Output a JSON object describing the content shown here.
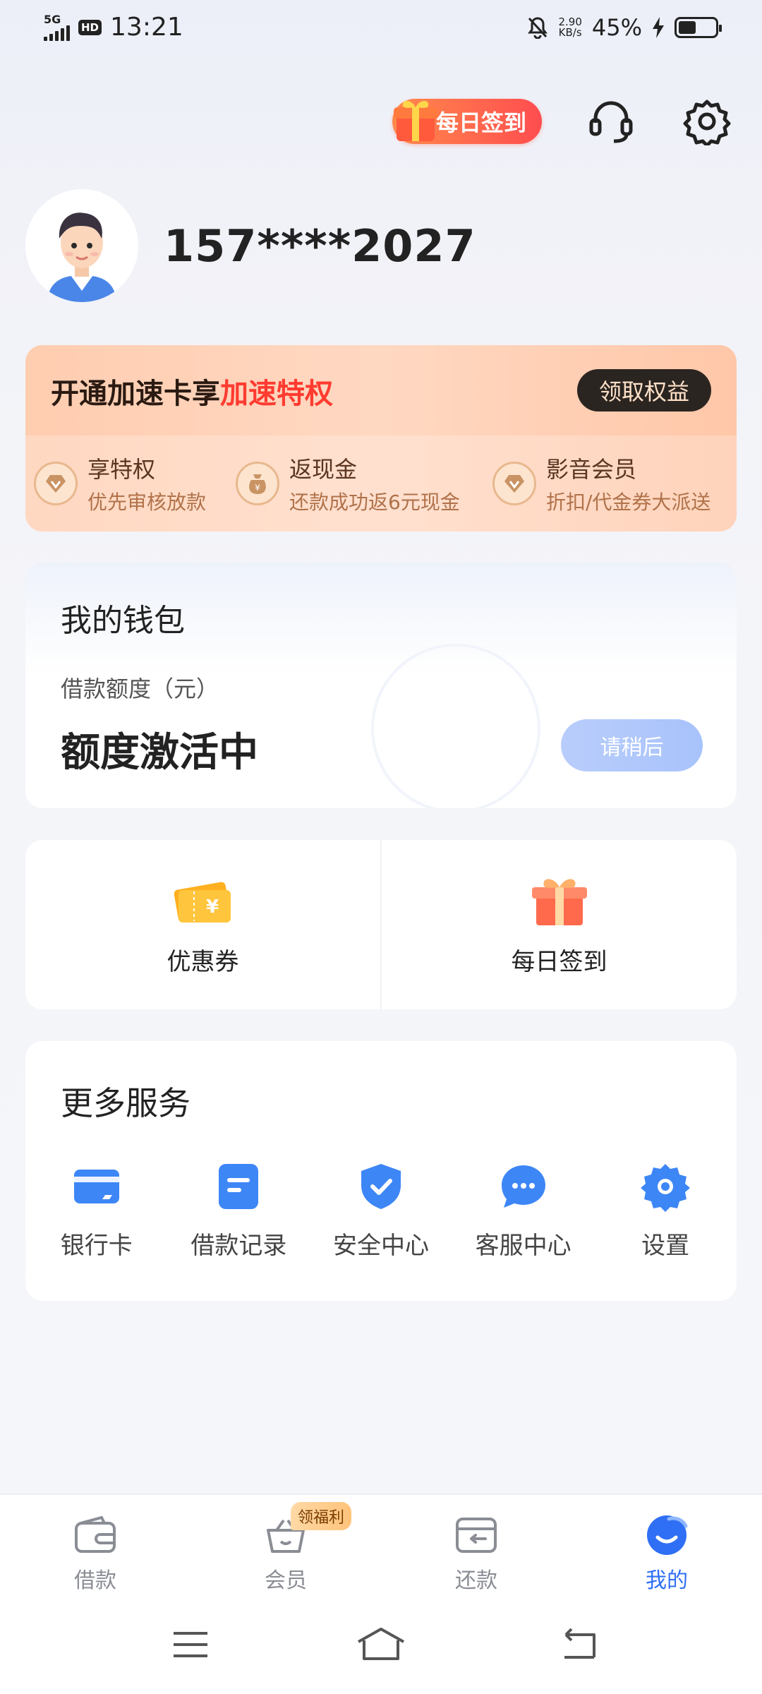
{
  "status_bar": {
    "network": "5G",
    "hd": "HD",
    "time": "13:21",
    "speed_value": "2.90",
    "speed_unit": "KB/s",
    "battery": "45%"
  },
  "header": {
    "checkin_label": "每日签到"
  },
  "profile": {
    "phone": "157****2027"
  },
  "promo": {
    "title_prefix": "开通加速卡享",
    "title_highlight": "加速特权",
    "button": "领取权益",
    "perks": [
      {
        "title": "享特权",
        "subtitle": "优先审核放款"
      },
      {
        "title": "返现金",
        "subtitle": "还款成功返6元现金"
      },
      {
        "title": "影音会员",
        "subtitle": "折扣/代金券大派送"
      }
    ]
  },
  "wallet": {
    "title": "我的钱包",
    "label": "借款额度（元）",
    "value": "额度激活中",
    "button": "请稍后"
  },
  "quick_actions": {
    "coupon": "优惠券",
    "checkin": "每日签到"
  },
  "services": {
    "title": "更多服务",
    "items": [
      {
        "label": "银行卡",
        "icon": "bank-card-icon"
      },
      {
        "label": "借款记录",
        "icon": "document-icon"
      },
      {
        "label": "安全中心",
        "icon": "shield-check-icon"
      },
      {
        "label": "客服中心",
        "icon": "chat-icon"
      },
      {
        "label": "设置",
        "icon": "gear-icon"
      }
    ]
  },
  "bottom_nav": {
    "items": [
      {
        "label": "借款"
      },
      {
        "label": "会员",
        "badge": "领福利"
      },
      {
        "label": "还款"
      },
      {
        "label": "我的"
      }
    ]
  },
  "colors": {
    "accent": "#2f6ff5",
    "promo_highlight": "#ff3b30",
    "service_icon": "#3d86f6"
  }
}
